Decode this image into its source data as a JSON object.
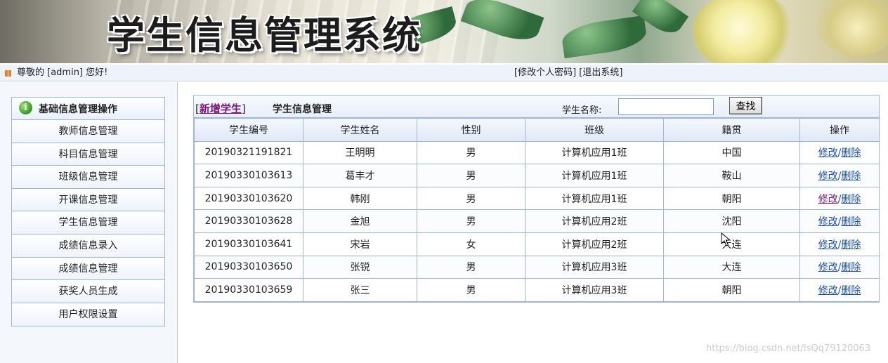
{
  "banner": {
    "title": "学生信息管理系统"
  },
  "topbar": {
    "greeting": "尊敬的 [admin] 您好!",
    "change_password": "[修改个人密码]",
    "logout": "[退出系统]"
  },
  "sidebar": {
    "header": "基础信息管理操作",
    "items": [
      {
        "label": "教师信息管理"
      },
      {
        "label": "科目信息管理"
      },
      {
        "label": "班级信息管理"
      },
      {
        "label": "开课信息管理"
      },
      {
        "label": "学生信息管理"
      },
      {
        "label": "成绩信息录入"
      },
      {
        "label": "成绩信息管理"
      },
      {
        "label": "获奖人员生成"
      },
      {
        "label": "用户权限设置"
      }
    ]
  },
  "main": {
    "add_open": "[",
    "add_label": "新增学生",
    "add_close": "]",
    "title": "学生信息管理",
    "search_label": "学生名称:",
    "search_value": "",
    "search_button": "查找",
    "columns": [
      "学生编号",
      "学生姓名",
      "性别",
      "班级",
      "籍贯",
      "操作"
    ],
    "rows": [
      {
        "id": "20190321191821",
        "name": "王明明",
        "gender": "男",
        "class": "计算机应用1班",
        "origin": "中国"
      },
      {
        "id": "20190330103613",
        "name": "葛丰才",
        "gender": "男",
        "class": "计算机应用1班",
        "origin": "鞍山"
      },
      {
        "id": "20190330103620",
        "name": "韩刚",
        "gender": "男",
        "class": "计算机应用1班",
        "origin": "朝阳"
      },
      {
        "id": "20190330103628",
        "name": "金旭",
        "gender": "男",
        "class": "计算机应用2班",
        "origin": "沈阳"
      },
      {
        "id": "20190330103641",
        "name": "宋岩",
        "gender": "女",
        "class": "计算机应用2班",
        "origin": "大连"
      },
      {
        "id": "20190330103650",
        "name": "张锐",
        "gender": "男",
        "class": "计算机应用3班",
        "origin": "大连"
      },
      {
        "id": "20190330103659",
        "name": "张三",
        "gender": "男",
        "class": "计算机应用3班",
        "origin": "朝阳"
      }
    ],
    "edit_label": "修改",
    "op_sep": "/",
    "delete_label": "删除"
  },
  "watermark": "https://blog.csdn.net/lsQq79120063"
}
